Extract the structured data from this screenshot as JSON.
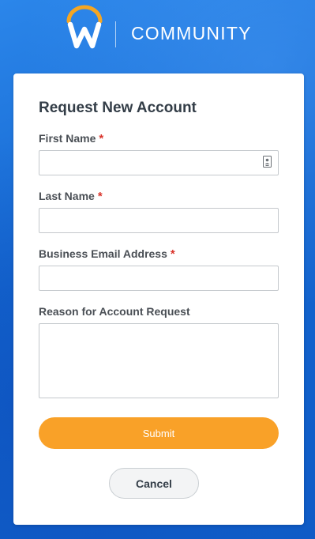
{
  "header": {
    "brand_text": "COMMUNITY",
    "logo_icon": "workday-w-logo-icon"
  },
  "form": {
    "title": "Request New Account",
    "fields": [
      {
        "label": "First Name",
        "required_mark": "*",
        "value": "",
        "placeholder": ""
      },
      {
        "label": "Last Name",
        "required_mark": "*",
        "value": "",
        "placeholder": ""
      },
      {
        "label": "Business Email Address",
        "required_mark": "*",
        "value": "",
        "placeholder": ""
      },
      {
        "label": "Reason for Account Request",
        "required_mark": "",
        "value": "",
        "placeholder": ""
      }
    ],
    "submit_label": "Submit",
    "cancel_label": "Cancel"
  },
  "colors": {
    "background_blue": "#1a72d9",
    "submit_orange": "#f9a128",
    "required_red": "#d9342b",
    "logo_arc_orange": "#f5a623"
  }
}
